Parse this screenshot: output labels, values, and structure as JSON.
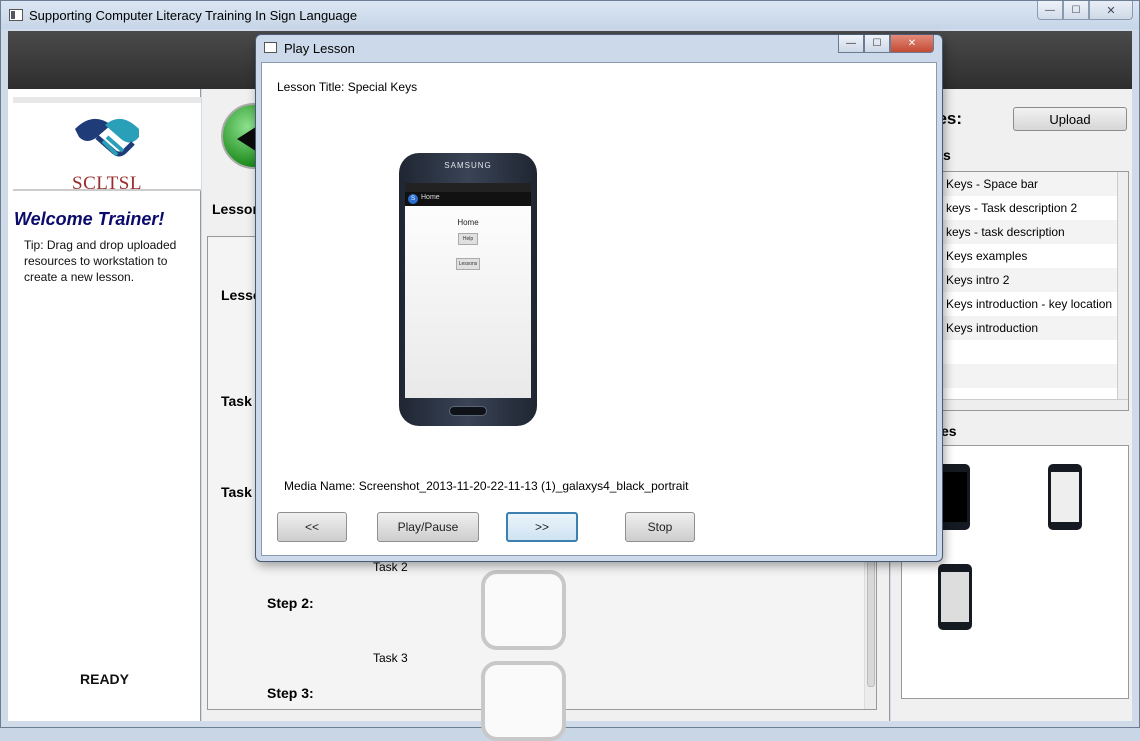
{
  "window": {
    "title": "Supporting Computer Literacy Training In Sign Language",
    "controls": {
      "minimize": "—",
      "maximize": "☐",
      "close": "✕"
    }
  },
  "left": {
    "logo_text": "SCLTSL",
    "welcome": "Welcome Trainer!",
    "tip": "Tip: Drag and drop uploaded resources to workstation to create a new lesson.",
    "status": "READY"
  },
  "center": {
    "lesson_header": "Lesson",
    "lesson_label": "Lesso",
    "task_label_1": "Task",
    "task_label_2": "Task",
    "task2_name": "Task 2",
    "task3_name": "Task 3",
    "step2": "Step 2:",
    "step3": "Step 3:"
  },
  "right": {
    "resources_title": "urces:",
    "upload_label": "Upload",
    "videos_title": "s",
    "images_title": "es",
    "resources": [
      "Keys - Space bar",
      "keys - Task description 2",
      "keys - task description",
      "Keys examples",
      "Keys intro 2",
      "Keys introduction - key location",
      "Keys introduction",
      "",
      ""
    ]
  },
  "dialog": {
    "title": "Play Lesson",
    "controls": {
      "minimize": "—",
      "maximize": "☐",
      "close": "✕"
    },
    "lesson_title": "Lesson Title: Special Keys",
    "media_name": "Media Name: Screenshot_2013-11-20-22-11-13 (1)_galaxys4_black_portrait",
    "phone": {
      "brand": "SAMSUNG",
      "app_title": "Home",
      "screen_heading": "Home",
      "button1": "Help",
      "button2": "Lessons"
    },
    "buttons": {
      "prev": "<<",
      "play_pause": "Play/Pause",
      "next": ">>",
      "stop": "Stop"
    }
  }
}
